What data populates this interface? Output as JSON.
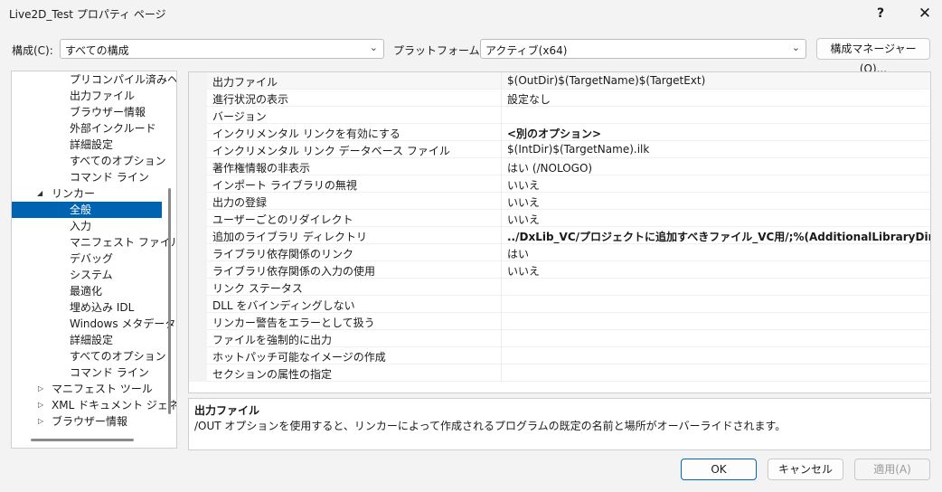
{
  "window": {
    "title": "Live2D_Test プロパティ ページ",
    "help_label": "?",
    "close_label": "✕"
  },
  "toolbar": {
    "config_label": "構成(C):",
    "config_value": "すべての構成",
    "platform_label": "プラットフォーム(P):",
    "platform_value": "アクティブ(x64)",
    "config_manager_label": "構成マネージャー(O)..."
  },
  "tree": {
    "items": [
      {
        "label": "プリコンパイル済みヘッ",
        "level": 2
      },
      {
        "label": "出力ファイル",
        "level": 2
      },
      {
        "label": "ブラウザー情報",
        "level": 2
      },
      {
        "label": "外部インクルード",
        "level": 2
      },
      {
        "label": "詳細設定",
        "level": 2
      },
      {
        "label": "すべてのオプション",
        "level": 2
      },
      {
        "label": "コマンド ライン",
        "level": 2
      },
      {
        "label": "リンカー",
        "level": 1,
        "twisty": "expanded"
      },
      {
        "label": "全般",
        "level": 2,
        "selected": true
      },
      {
        "label": "入力",
        "level": 2
      },
      {
        "label": "マニフェスト ファイル",
        "level": 2
      },
      {
        "label": "デバッグ",
        "level": 2
      },
      {
        "label": "システム",
        "level": 2
      },
      {
        "label": "最適化",
        "level": 2
      },
      {
        "label": "埋め込み IDL",
        "level": 2
      },
      {
        "label": "Windows メタデータ",
        "level": 2
      },
      {
        "label": "詳細設定",
        "level": 2
      },
      {
        "label": "すべてのオプション",
        "level": 2
      },
      {
        "label": "コマンド ライン",
        "level": 2
      },
      {
        "label": "マニフェスト ツール",
        "level": 1,
        "twisty": "collapsed"
      },
      {
        "label": "XML ドキュメント ジェネレー",
        "level": 1,
        "twisty": "collapsed"
      },
      {
        "label": "ブラウザー情報",
        "level": 1,
        "twisty": "collapsed"
      }
    ]
  },
  "grid": {
    "rows": [
      {
        "name": "出力ファイル",
        "value": "$(OutDir)$(TargetName)$(TargetExt)",
        "bold": false
      },
      {
        "name": "進行状況の表示",
        "value": "設定なし",
        "bold": false
      },
      {
        "name": "バージョン",
        "value": "",
        "bold": false
      },
      {
        "name": "インクリメンタル リンクを有効にする",
        "value": "<別のオプション>",
        "bold": true
      },
      {
        "name": "インクリメンタル リンク データベース ファイル",
        "value": "$(IntDir)$(TargetName).ilk",
        "bold": false
      },
      {
        "name": "著作権情報の非表示",
        "value": "はい (/NOLOGO)",
        "bold": false
      },
      {
        "name": "インポート ライブラリの無視",
        "value": "いいえ",
        "bold": false
      },
      {
        "name": "出力の登録",
        "value": "いいえ",
        "bold": false
      },
      {
        "name": "ユーザーごとのリダイレクト",
        "value": "いいえ",
        "bold": false
      },
      {
        "name": "追加のライブラリ ディレクトリ",
        "value": "../DxLib_VC/プロジェクトに追加すべきファイル_VC用/;%(AdditionalLibraryDirectories)",
        "bold": true
      },
      {
        "name": "ライブラリ依存関係のリンク",
        "value": "はい",
        "bold": false
      },
      {
        "name": "ライブラリ依存関係の入力の使用",
        "value": "いいえ",
        "bold": false
      },
      {
        "name": "リンク ステータス",
        "value": "",
        "bold": false
      },
      {
        "name": "DLL をバインディングしない",
        "value": "",
        "bold": false
      },
      {
        "name": "リンカー警告をエラーとして扱う",
        "value": "",
        "bold": false
      },
      {
        "name": "ファイルを強制的に出力",
        "value": "",
        "bold": false
      },
      {
        "name": "ホットパッチ可能なイメージの作成",
        "value": "",
        "bold": false
      },
      {
        "name": "セクションの属性の指定",
        "value": "",
        "bold": false
      }
    ]
  },
  "description": {
    "title": "出力ファイル",
    "text": "/OUT オプションを使用すると、リンカーによって作成されるプログラムの既定の名前と場所がオーバーライドされます。"
  },
  "buttons": {
    "ok": "OK",
    "cancel": "キャンセル",
    "apply": "適用(A)"
  },
  "colors": {
    "selection": "#0063b1",
    "ok_border": "#0067c0",
    "disabled_text": "#9a9a9a"
  }
}
